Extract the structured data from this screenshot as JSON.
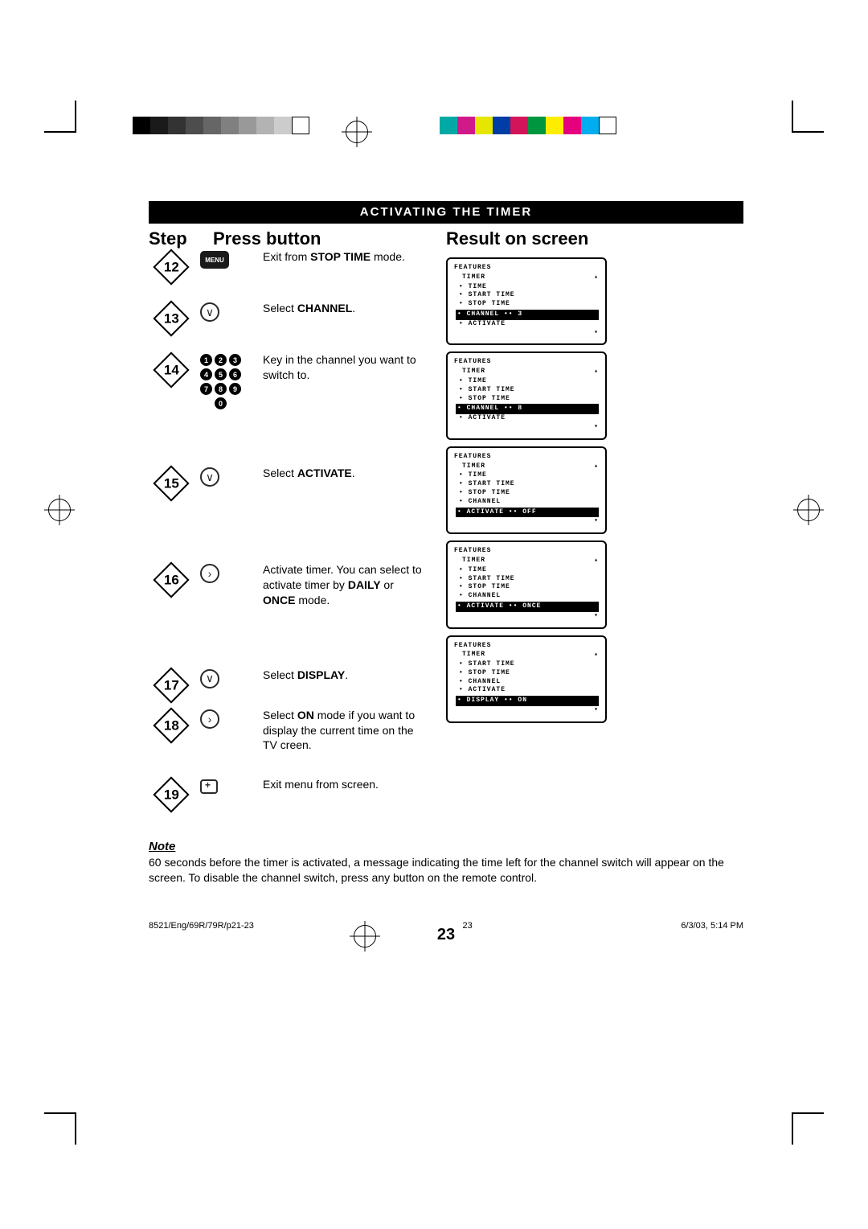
{
  "crop_bars_left": [
    "#000000",
    "#1a1a1a",
    "#333333",
    "#4d4d4d",
    "#666666",
    "#808080",
    "#999999",
    "#b3b3b3",
    "#cccccc",
    "#ffffff"
  ],
  "crop_bars_right": [
    "#00a9a5",
    "#d11a8a",
    "#e6e600",
    "#003da5",
    "#d4145a",
    "#009640",
    "#ffed00",
    "#e5007e",
    "#00aeef",
    "#ffffff"
  ],
  "title": "ACTIVATING THE TIMER",
  "columns": {
    "step": "Step",
    "press": "Press button",
    "result": "Result on screen"
  },
  "steps": [
    {
      "num": "12",
      "button": {
        "type": "menu",
        "label": "MENU"
      },
      "desc": [
        {
          "t": "Exit from "
        },
        {
          "b": "STOP TIME"
        },
        {
          "t": " mode."
        }
      ]
    },
    {
      "num": "13",
      "button": {
        "type": "down",
        "glyph": "∨"
      },
      "desc": [
        {
          "t": "Select "
        },
        {
          "b": "CHANNEL"
        },
        {
          "t": "."
        }
      ]
    },
    {
      "num": "14",
      "button": {
        "type": "keypad",
        "keys": [
          "1",
          "2",
          "3",
          "4",
          "5",
          "6",
          "7",
          "8",
          "9",
          "0"
        ]
      },
      "desc": [
        {
          "t": "Key in the channel you want to switch to."
        }
      ]
    },
    {
      "num": "15",
      "button": {
        "type": "down",
        "glyph": "∨"
      },
      "desc": [
        {
          "t": "Select "
        },
        {
          "b": "ACTIVATE"
        },
        {
          "t": "."
        }
      ]
    },
    {
      "num": "16",
      "button": {
        "type": "right",
        "glyph": "›"
      },
      "desc": [
        {
          "t": "Activate timer. You can select to activate timer by "
        },
        {
          "b": "DAILY"
        },
        {
          "t": " or "
        },
        {
          "b": "ONCE"
        },
        {
          "t": "  mode."
        }
      ]
    },
    {
      "num": "17",
      "button": {
        "type": "down",
        "glyph": "∨"
      },
      "desc": [
        {
          "t": "Select "
        },
        {
          "b": "DISPLAY"
        },
        {
          "t": "."
        }
      ]
    },
    {
      "num": "18",
      "button": {
        "type": "right",
        "glyph": "›"
      },
      "desc": [
        {
          "t": "Select "
        },
        {
          "b": "ON"
        },
        {
          "t": " mode if you want to display the current time on the TV creen."
        }
      ]
    },
    {
      "num": "19",
      "button": {
        "type": "tv"
      },
      "desc": [
        {
          "t": "Exit menu from screen."
        }
      ]
    }
  ],
  "screens": [
    {
      "hdr": "FEATURES",
      "sub": "TIMER",
      "items": [
        "• TIME",
        "• START TIME",
        "• STOP TIME"
      ],
      "hl": "• CHANNEL      ••    3",
      "after": [
        "• ACTIVATE"
      ]
    },
    {
      "hdr": "FEATURES",
      "sub": "TIMER",
      "items": [
        "• TIME",
        "• START TIME",
        "• STOP TIME"
      ],
      "hl": "• CHANNEL      ••    8",
      "after": [
        "• ACTIVATE"
      ]
    },
    {
      "hdr": "FEATURES",
      "sub": "TIMER",
      "items": [
        "• TIME",
        "• START TIME",
        "• STOP TIME",
        "• CHANNEL"
      ],
      "hl": "• ACTIVATE     ••   OFF",
      "after": []
    },
    {
      "hdr": "FEATURES",
      "sub": "TIMER",
      "items": [
        "• TIME",
        "• START TIME",
        "• STOP TIME",
        "• CHANNEL"
      ],
      "hl": "• ACTIVATE     ••  ONCE",
      "after": []
    },
    {
      "hdr": "FEATURES",
      "sub": "TIMER",
      "items": [
        "• START TIME",
        "• STOP TIME",
        "• CHANNEL",
        "• ACTIVATE"
      ],
      "hl": "• DISPLAY      ••    ON",
      "after": []
    }
  ],
  "note": {
    "heading": "Note",
    "body": "60 seconds before the timer is activated, a message indicating the time left for the channel switch will appear on the screen. To disable the channel switch, press any button on the remote control."
  },
  "page_num": "23",
  "footer": {
    "left": "8521/Eng/69R/79R/p21-23",
    "mid": "23",
    "right": "6/3/03, 5:14 PM"
  }
}
